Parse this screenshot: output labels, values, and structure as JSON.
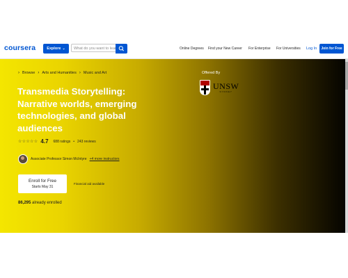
{
  "header": {
    "logo": "coursera",
    "explore_label": "Explore",
    "search_placeholder": "What do you want to learn?",
    "nav_links": [
      "Online Degrees",
      "Find your New Career",
      "For Enterprise",
      "For Universities"
    ],
    "login_label": "Log In",
    "join_label": "Join for Free"
  },
  "hero": {
    "breadcrumb": [
      "Browse",
      "Arts and Humanities",
      "Music and Art"
    ],
    "title": "Transmedia Storytelling: Narrative worlds, emerging technologies, and global audiences",
    "rating": "4.7",
    "ratings_count": "688 ratings",
    "reviews_count": "243 reviews",
    "instructor": "Associate Professor Simon McIntyre",
    "more_instructors": "+4 more instructors",
    "enroll_label": "Enroll for Free",
    "enroll_sub": "Starts May 31",
    "financial_aid": "Financial aid available",
    "enrolled_count": "86,295",
    "enrolled_suffix": "already enrolled",
    "offered_by": "Offered By",
    "partner_logo_text": "UNSW",
    "partner_logo_sub": "SYDNEY"
  },
  "colors": {
    "brand_blue": "#0056d2",
    "hero_start": "#f4e600",
    "hero_end": "#050400"
  },
  "icons": {
    "search_button": "search-icon",
    "explore_chevron": "chevron-down-icon",
    "rating_stars": "star-icon"
  }
}
